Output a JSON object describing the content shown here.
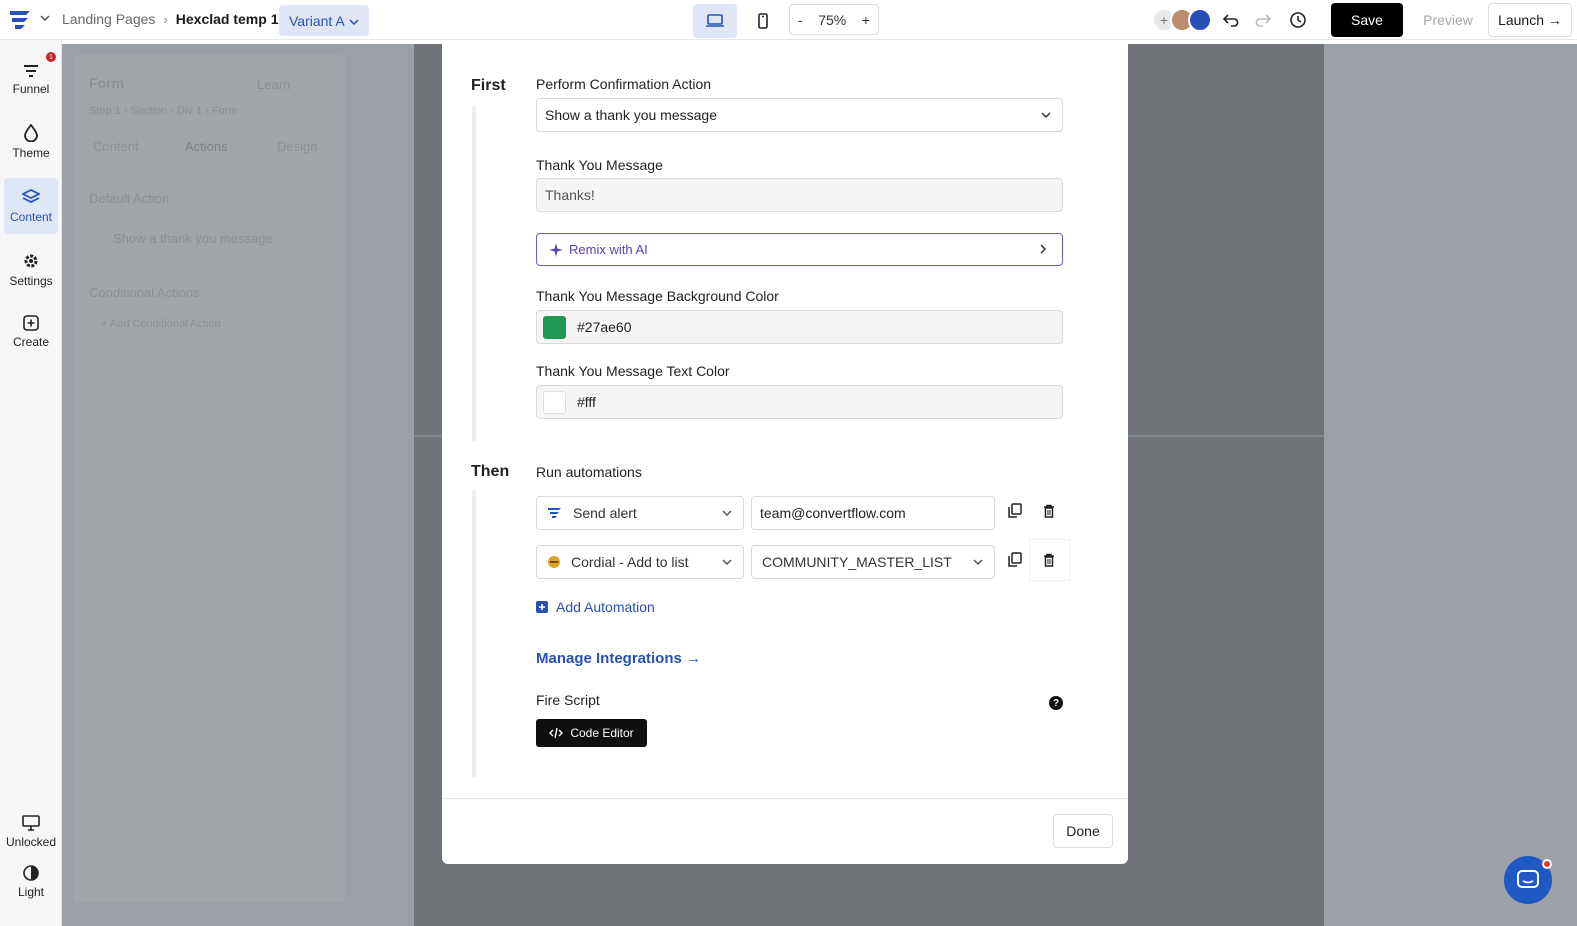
{
  "topbar": {
    "breadcrumb": [
      "Landing Pages",
      "Hexclad temp 1"
    ],
    "variant": "Variant A",
    "zoom": {
      "minus": "-",
      "value": "75%",
      "plus": "+"
    },
    "save": "Save",
    "preview": "Preview",
    "launch": "Launch →"
  },
  "rail": {
    "items": [
      {
        "label": "Funnel",
        "badge": "1"
      },
      {
        "label": "Theme"
      },
      {
        "label": "Content"
      },
      {
        "label": "Settings"
      },
      {
        "label": "Create"
      }
    ],
    "bottom": [
      {
        "label": "Unlocked"
      },
      {
        "label": "Light"
      }
    ]
  },
  "background_panel": {
    "title": "Form",
    "learn": "Learn",
    "path": "Step 1 › Section › Div 1 › Form",
    "tabs": [
      "Content",
      "Actions",
      "Design"
    ],
    "default_action_label": "Default Action",
    "default_action_value": "Show a thank you message",
    "conditional_label": "Conditional Actions",
    "add_conditional": "+ Add Conditional Action"
  },
  "modal": {
    "first": {
      "heading": "First",
      "action_label": "Perform Confirmation Action",
      "action_value": "Show a thank you message",
      "message_label": "Thank You Message",
      "message_value": "Thanks!",
      "remix": "Remix with AI",
      "bg_color_label": "Thank You Message Background Color",
      "bg_color_value": "#27ae60",
      "text_color_label": "Thank You Message Text Color",
      "text_color_value": "#fff"
    },
    "then": {
      "heading": "Then",
      "run_label": "Run automations",
      "automations": [
        {
          "type": "Send alert",
          "value": "team@convertflow.com"
        },
        {
          "type": "Cordial - Add to list",
          "value": "COMMUNITY_MASTER_LIST"
        }
      ],
      "add_automation": "Add Automation",
      "manage_integrations": "Manage Integrations →",
      "fire_script_label": "Fire Script",
      "code_editor": "Code Editor",
      "help": "?"
    },
    "done": "Done"
  },
  "colors": {
    "accent": "#2850b8",
    "swatch_bg": "#1f9a55",
    "swatch_text": "#ffffff",
    "remix": "#5b3fb8",
    "primary_button": "#000000"
  }
}
